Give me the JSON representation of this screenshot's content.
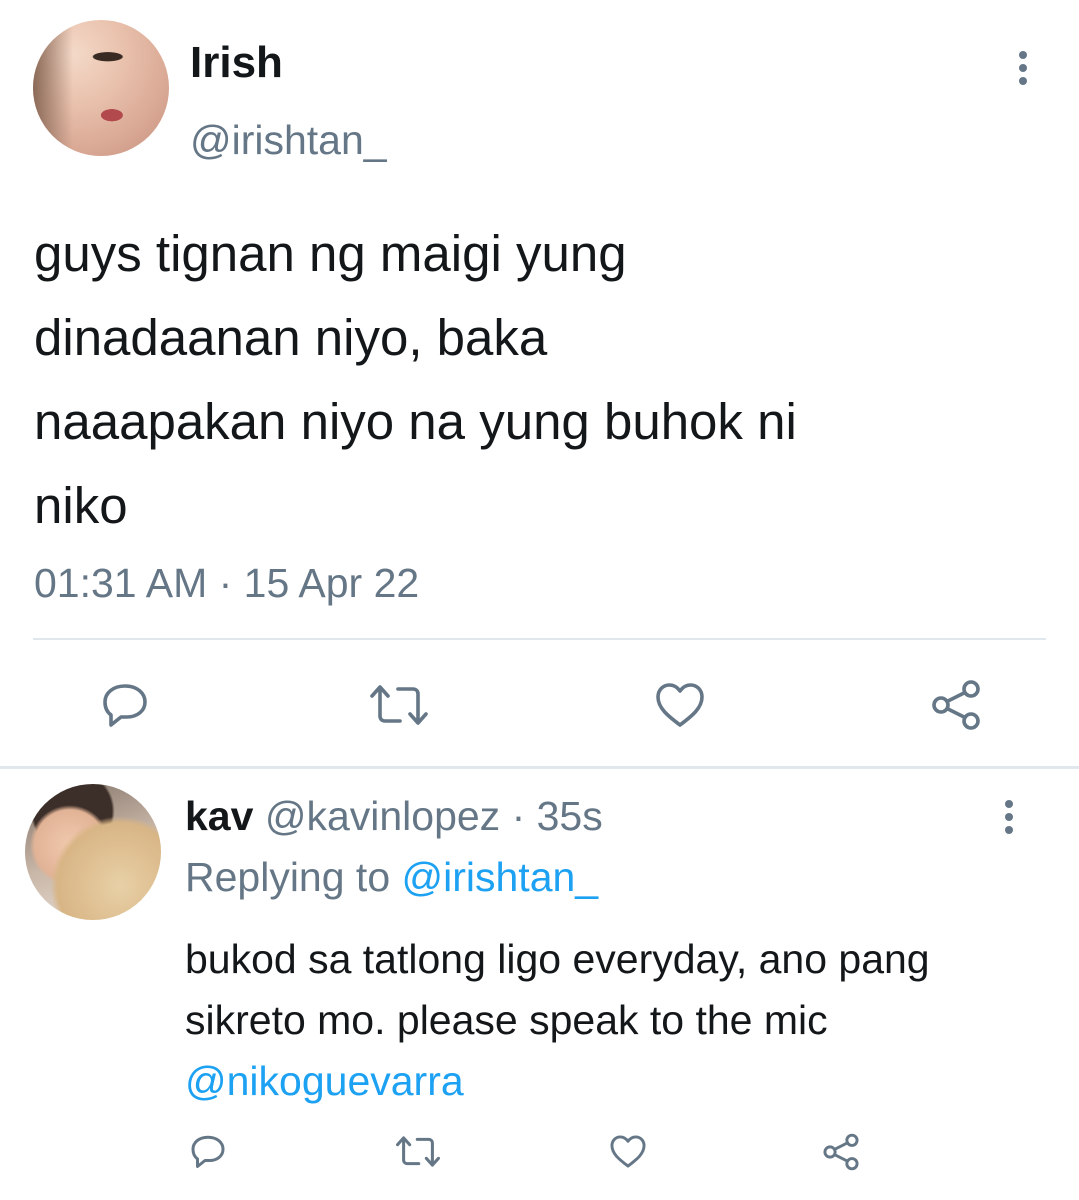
{
  "tweet": {
    "display_name": "Irish",
    "handle": "@irishtan_",
    "text": "guys tignan ng maigi yung\ndinadaanan niyo, baka\nnaaapakan niyo na yung buhok ni\nniko",
    "timestamp": "01:31 AM · 15 Apr 22",
    "actions": [
      "reply-icon",
      "retweet-icon",
      "like-icon",
      "share-icon"
    ]
  },
  "reply": {
    "display_name": "kav",
    "handle": "@kavinlopez",
    "separator": " · ",
    "time": "35s",
    "replying_prefix": "Replying to ",
    "replying_to": "@irishtan_",
    "text_main": "bukod sa tatlong ligo everyday, ano pang sikreto mo. please speak to the mic ",
    "mention": "@nikoguevarra",
    "actions": [
      "reply-icon",
      "retweet-icon",
      "like-icon",
      "share-icon"
    ]
  },
  "colors": {
    "text": "#14171a",
    "secondary": "#657786",
    "link": "#1da1f2",
    "icon": "#657786",
    "divider": "#e1e8ed"
  }
}
